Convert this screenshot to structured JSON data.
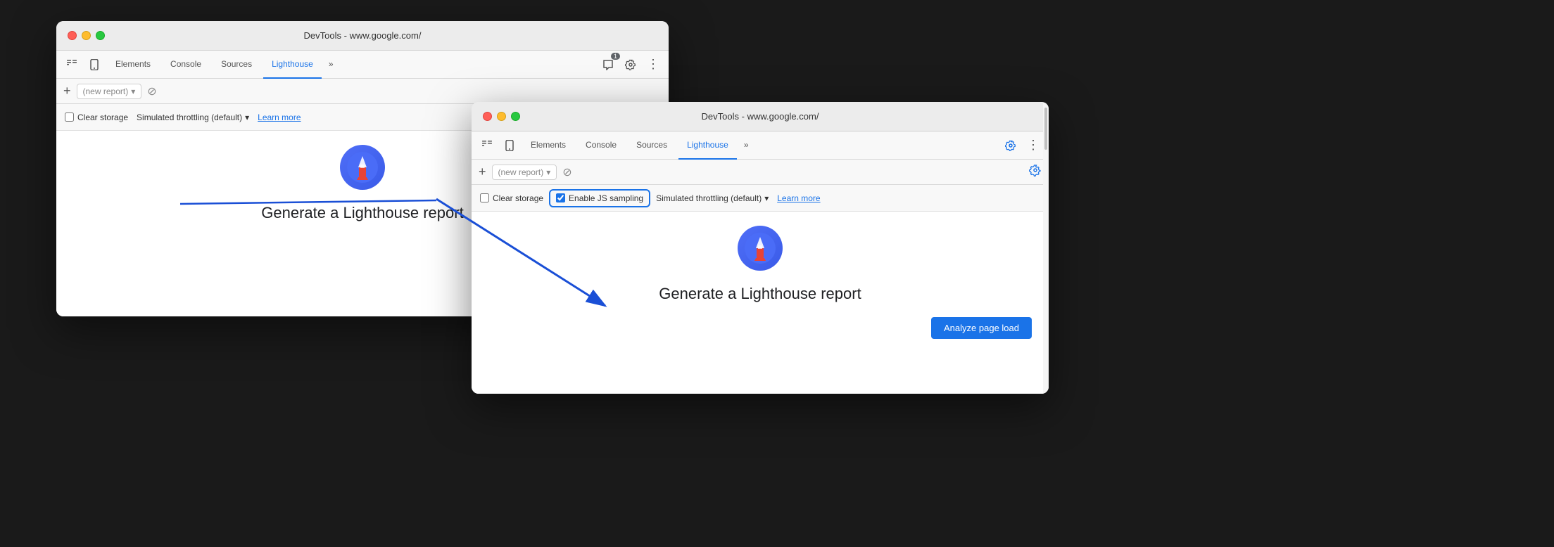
{
  "window1": {
    "title": "DevTools - www.google.com/",
    "tabs": [
      {
        "label": "Elements",
        "active": false
      },
      {
        "label": "Console",
        "active": false
      },
      {
        "label": "Sources",
        "active": false
      },
      {
        "label": "Lighthouse",
        "active": true
      },
      {
        "label": "»",
        "active": false
      }
    ],
    "toolbar2": {
      "plus": "+",
      "new_report": "(new report)",
      "dropdown_arrow": "▾",
      "cancel_icon": "⊘"
    },
    "options": {
      "clear_storage": "Clear storage",
      "simulated_throttling": "Simulated throttling (default)",
      "learn_more": "Learn more"
    },
    "main": {
      "generate_title": "Generate a Lighthouse report"
    }
  },
  "window2": {
    "title": "DevTools - www.google.com/",
    "tabs": [
      {
        "label": "Elements",
        "active": false
      },
      {
        "label": "Console",
        "active": false
      },
      {
        "label": "Sources",
        "active": false
      },
      {
        "label": "Lighthouse",
        "active": true
      },
      {
        "label": "»",
        "active": false
      }
    ],
    "toolbar2": {
      "plus": "+",
      "new_report": "(new report)",
      "dropdown_arrow": "▾",
      "cancel_icon": "⊘"
    },
    "options": {
      "clear_storage": "Clear storage",
      "enable_js_sampling": "Enable JS sampling",
      "simulated_throttling": "Simulated throttling (default)",
      "learn_more": "Learn more"
    },
    "main": {
      "generate_title": "Generate a Lighthouse report",
      "analyze_btn": "Analyze page load"
    }
  },
  "icons": {
    "selector": "⠿",
    "mobile": "⬛",
    "chat": "💬",
    "gear": "⚙",
    "more": "⋮",
    "badge_count": "1"
  }
}
